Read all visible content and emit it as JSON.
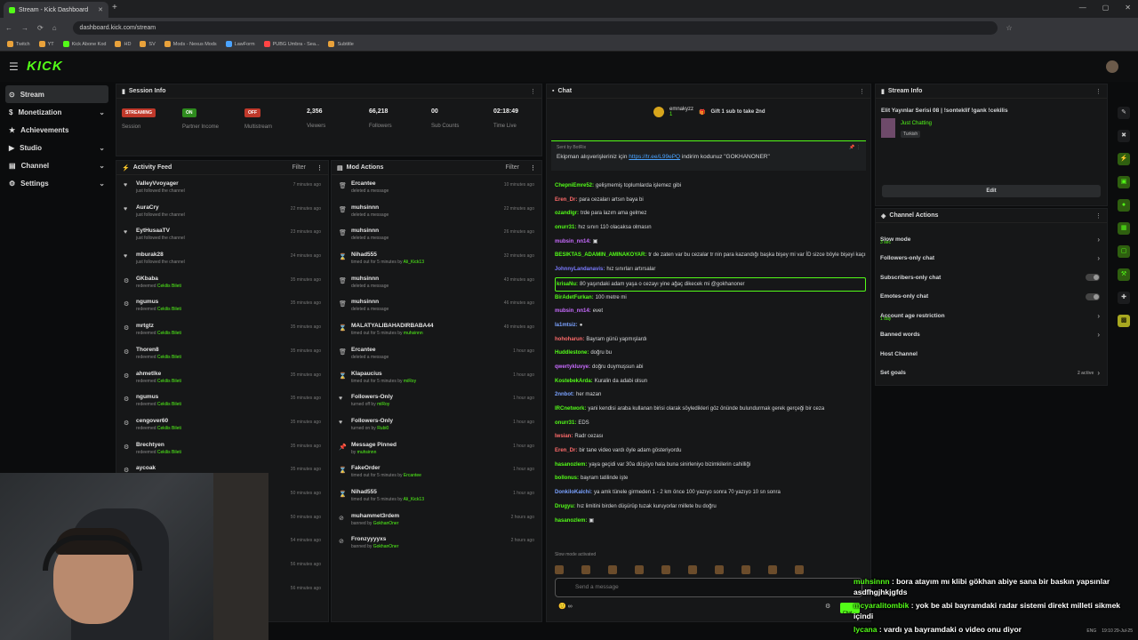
{
  "browser": {
    "tab_title": "Stream - Kick Dashboard",
    "url": "dashboard.kick.com/stream",
    "bookmarks": [
      "Twitch",
      "YT",
      "Kick Abone Kod",
      "HD",
      "SV",
      "Mods - Nexus Mods",
      "LawForm",
      "PUBG Umbra - Sea...",
      "Subtitle"
    ]
  },
  "app": {
    "logo": "KICK",
    "nav": [
      {
        "label": "Stream",
        "active": true
      },
      {
        "label": "Monetization",
        "chevron": "⌄"
      },
      {
        "label": "Achievements"
      },
      {
        "label": "Studio",
        "chevron": "⌄"
      },
      {
        "label": "Channel",
        "chevron": "⌄"
      },
      {
        "label": "Settings",
        "chevron": "⌄"
      }
    ]
  },
  "session": {
    "title": "Session Info",
    "stats": [
      {
        "value": "STREAMING",
        "label": "Session",
        "badge_color": "#c0392b"
      },
      {
        "value": "ON",
        "label": "Partner Income",
        "badge_color": "#2e8b1e"
      },
      {
        "value": "OFF",
        "label": "Multistream",
        "badge_color": "#c0392b"
      },
      {
        "value": "2,356",
        "label": "Viewers"
      },
      {
        "value": "66,218",
        "label": "Followers"
      },
      {
        "value": "00",
        "label": "Sub Counts"
      },
      {
        "value": "02:18:49",
        "label": "Time Live"
      }
    ]
  },
  "activity": {
    "title": "Activity Feed",
    "filter": "Filter",
    "items": [
      {
        "icon": "♥",
        "name": "ValleyVvoyager",
        "sub": "just followed the channel",
        "hl": "",
        "time": "7 minutes ago"
      },
      {
        "icon": "♥",
        "name": "AuraCry",
        "sub": "just followed the channel",
        "hl": "",
        "time": "22 minutes ago"
      },
      {
        "icon": "♥",
        "name": "EytHusaaTV",
        "sub": "just followed the channel",
        "hl": "",
        "time": "23 minutes ago"
      },
      {
        "icon": "♥",
        "name": "mburak28",
        "sub": "just followed the channel",
        "hl": "",
        "time": "24 minutes ago"
      },
      {
        "icon": "⚙",
        "name": "GKbaba",
        "sub": "redeemed ",
        "hl": "Cekilis Bileti",
        "time": "35 minutes ago"
      },
      {
        "icon": "⚙",
        "name": "ngumus",
        "sub": "redeemed ",
        "hl": "Cekilis Bileti",
        "time": "35 minutes ago"
      },
      {
        "icon": "⚙",
        "name": "mrtgtz",
        "sub": "redeemed ",
        "hl": "Cekilis Bileti",
        "time": "35 minutes ago"
      },
      {
        "icon": "⚙",
        "name": "Thoren8",
        "sub": "redeemed ",
        "hl": "Cekilis Bileti",
        "time": "35 minutes ago"
      },
      {
        "icon": "⚙",
        "name": "ahmetlke",
        "sub": "redeemed ",
        "hl": "Cekilis Bileti",
        "time": "35 minutes ago"
      },
      {
        "icon": "⚙",
        "name": "ngumus",
        "sub": "redeemed ",
        "hl": "Cekilis Bileti",
        "time": "35 minutes ago"
      },
      {
        "icon": "⚙",
        "name": "cengover60",
        "sub": "redeemed ",
        "hl": "Cekilis Bileti",
        "time": "35 minutes ago"
      },
      {
        "icon": "⚙",
        "name": "Brechtyen",
        "sub": "redeemed ",
        "hl": "Cekilis Bileti",
        "time": "35 minutes ago"
      },
      {
        "icon": "⚙",
        "name": "aycoak",
        "sub": "",
        "hl": "",
        "time": "35 minutes ago"
      },
      {
        "icon": "",
        "name": "",
        "sub": "",
        "hl": "",
        "time": "50 minutes ago"
      },
      {
        "icon": "",
        "name": "",
        "sub": "",
        "hl": "",
        "time": "50 minutes ago"
      },
      {
        "icon": "",
        "name": "",
        "sub": "",
        "hl": "",
        "time": "54 minutes ago"
      },
      {
        "icon": "",
        "name": "",
        "sub": "",
        "hl": "",
        "time": "56 minutes ago"
      },
      {
        "icon": "",
        "name": "",
        "sub": "",
        "hl": "",
        "time": "56 minutes ago"
      }
    ]
  },
  "mod": {
    "title": "Mod Actions",
    "filter": "Filter",
    "items": [
      {
        "icon": "🗑",
        "name": "Ercantee",
        "sub": "deleted a message",
        "hl": "",
        "time": "10 minutes ago"
      },
      {
        "icon": "🗑",
        "name": "muhsinnn",
        "sub": "deleted a message",
        "hl": "",
        "time": "22 minutes ago"
      },
      {
        "icon": "🗑",
        "name": "muhsinnn",
        "sub": "deleted a message",
        "hl": "",
        "time": "26 minutes ago"
      },
      {
        "icon": "⌛",
        "name": "Nihad555",
        "sub": "timed out for 5 minutes by ",
        "hl": "Ali_Kick13",
        "time": "32 minutes ago"
      },
      {
        "icon": "🗑",
        "name": "muhsinnn",
        "sub": "deleted a message",
        "hl": "",
        "time": "43 minutes ago"
      },
      {
        "icon": "🗑",
        "name": "muhsinnn",
        "sub": "deleted a message",
        "hl": "",
        "time": "46 minutes ago"
      },
      {
        "icon": "⌛",
        "name": "MALATYALIBAHADIRBABA44",
        "sub": "timed out for 5 minutes by ",
        "hl": "muhsinnn",
        "time": "49 minutes ago"
      },
      {
        "icon": "🗑",
        "name": "Ercantee",
        "sub": "deleted a message",
        "hl": "",
        "time": "1 hour ago"
      },
      {
        "icon": "⌛",
        "name": "Klapaucius",
        "sub": "timed out for 5 minutes by ",
        "hl": "miRoy",
        "time": "1 hour ago"
      },
      {
        "icon": "♥",
        "name": "Followers-Only",
        "sub": "turned off by ",
        "hl": "miRoy",
        "time": "1 hour ago"
      },
      {
        "icon": "♥",
        "name": "Followers-Only",
        "sub": "turned on by ",
        "hl": "Rubi0",
        "time": "1 hour ago"
      },
      {
        "icon": "📌",
        "name": "Message Pinned",
        "sub": "by ",
        "hl": "muhsinnn",
        "time": "1 hour ago"
      },
      {
        "icon": "⌛",
        "name": "FakeOrder",
        "sub": "timed out for 5 minutes by ",
        "hl": "Ercantee",
        "time": "1 hour ago"
      },
      {
        "icon": "⌛",
        "name": "Nihad555",
        "sub": "timed out for 5 minutes by ",
        "hl": "Ali_Kick13",
        "time": "1 hour ago"
      },
      {
        "icon": "⊘",
        "name": "muhammet3rdem",
        "sub": "banned by ",
        "hl": "GokhanOner",
        "time": "2 hours ago"
      },
      {
        "icon": "⊘",
        "name": "Fronzyyyyxs",
        "sub": "banned by ",
        "hl": "GokhanOner",
        "time": "2 hours ago"
      }
    ]
  },
  "chat": {
    "title": "Chat",
    "gift_user": "emnakyzz",
    "gift_count": "1",
    "gift_text": "Gift 1 sub to take 2nd",
    "pinned_meta": "Sent by BotRix",
    "pinned_pre": "Ekipman alışverişleriniz için ",
    "pinned_link": "https://tr.ee/L99ePQ",
    "pinned_post": " indirim kodunuz \"GOKHANONER\"",
    "messages": [
      {
        "u": "ChepniEmre52",
        "c": "#53fc18",
        "t": "gelişmemiş toplumlarda işlemez gibi"
      },
      {
        "u": "Eren_Dr",
        "c": "#ff6b6b",
        "t": "para cezaları artsın baya bi"
      },
      {
        "u": "ozandlgr",
        "c": "#53fc18",
        "t": "trde para lazım ama gelmez"
      },
      {
        "u": "onurr31",
        "c": "#53fc18",
        "t": "hız sınırı 110 olacaksa olmasın"
      },
      {
        "u": "mubsin_nn14",
        "c": "#c86bff",
        "t": "▣"
      },
      {
        "u": "BESIKTAS_ADAMIN_AMINAKOYAR",
        "c": "#53fc18",
        "t": "tr de zaten var bu cezalar tr nin para kazandığı başka bişey mi var İD sizce böyle bişeyi kaçırır mı"
      },
      {
        "u": "JohnnyLandanavis",
        "c": "#7a7aff",
        "t": "hız sınırları artırsalar"
      },
      {
        "u": "krisaNu",
        "c": "#53fc18",
        "t": "80 yaşındaki adam yaşa o cezayı yine ağaç dikecek mi @gokhanoner",
        "hl": true
      },
      {
        "u": "BirAdetFurkan",
        "c": "#53fc18",
        "t": "100 metre mi"
      },
      {
        "u": "mubsin_nn14",
        "c": "#c86bff",
        "t": "evet"
      },
      {
        "u": "Ia1mtsiz",
        "c": "#7aa2ff",
        "t": "●"
      },
      {
        "u": "hohoharun",
        "c": "#ff6b6b",
        "t": "Bayram günü yapmışlardı"
      },
      {
        "u": "Huddlestone",
        "c": "#53fc18",
        "t": "doğru bu"
      },
      {
        "u": "qwertykluvye",
        "c": "#c86bff",
        "t": "doğru duymuşsun abi"
      },
      {
        "u": "KostebekArda",
        "c": "#53fc18",
        "t": "Kuralin da adabi olsun"
      },
      {
        "u": "2nnbot",
        "c": "#7aa2ff",
        "t": "her mazan"
      },
      {
        "u": "IRCnetwork",
        "c": "#53fc18",
        "t": "yani kendisi araba kullanan birisi olarak söyledikleri göz önünde bulundurmak gerek gerçeği bir ceza"
      },
      {
        "u": "onurr31",
        "c": "#53fc18",
        "t": "EDS"
      },
      {
        "u": "Iwsian",
        "c": "#ff6b6b",
        "t": "Radr cezası"
      },
      {
        "u": "Eren_Dr",
        "c": "#ff6b6b",
        "t": "bir tane video vardı öyle adam gösteriyordu"
      },
      {
        "u": "hasanozlem",
        "c": "#53fc18",
        "t": "yaya geçidi var 30a düşüyo hala buna sinirleniyo bizimkilerin cahilliği"
      },
      {
        "u": "bollonus",
        "c": "#53fc18",
        "t": "bayram tatilinde işte"
      },
      {
        "u": "DonkiloKalchi",
        "c": "#7aa2ff",
        "t": "ya amk tünele girmeden 1 - 2 km önce 100 yazıyo sonra 70 yazıyo 10 sn sonra"
      },
      {
        "u": "Drugyu",
        "c": "#53fc18",
        "t": "hız limitini birden düşürüp tuzak kuruyorlar millete bu doğru"
      },
      {
        "u": "hasanozlem",
        "c": "#53fc18",
        "t": "▣"
      }
    ],
    "slow_mode_note": "Slow mode activated",
    "input_placeholder": "Send a message",
    "send_label": "Chat"
  },
  "stream_info": {
    "title": "Stream Info",
    "stream_title": "Elit Yayınlar Serisi 08 | !sonteklif !gank !cekilis",
    "category": "Just Chatting",
    "tag": "Turkish",
    "edit_label": "Edit"
  },
  "channel_actions": {
    "title": "Channel Actions",
    "items": [
      {
        "label": "Slow mode",
        "sub": "3 sec",
        "kind": "arrow"
      },
      {
        "label": "Followers-only chat",
        "sub": "",
        "kind": "arrow"
      },
      {
        "label": "Subscribers-only chat",
        "sub": "",
        "kind": "toggle"
      },
      {
        "label": "Emotes-only chat",
        "sub": "",
        "kind": "toggle"
      },
      {
        "label": "Account age restriction",
        "sub": "1 day",
        "kind": "arrow"
      },
      {
        "label": "Banned words",
        "sub": "",
        "kind": "arrow"
      },
      {
        "label": "Host Channel",
        "sub": "",
        "kind": "none"
      },
      {
        "label": "Set goals",
        "sub": "",
        "kind": "arrow",
        "extra": "2 active"
      }
    ]
  },
  "overlay": [
    {
      "u": "muhsinnn",
      "t": "bora atayım mı klibi gökhan abiye sana bir baskın yapsınlar asdfhgjhkjgfds"
    },
    {
      "u": "mcyaralitombik",
      "t": "yok be abi bayramdaki radar sistemi direkt milleti sikmek içindi"
    },
    {
      "u": "lycana",
      "t": "vardı ya bayramdaki o video onu diyor"
    }
  ],
  "taskbar": {
    "lang": "ENG",
    "time": "19:10",
    "date": "29-Jul-25"
  }
}
